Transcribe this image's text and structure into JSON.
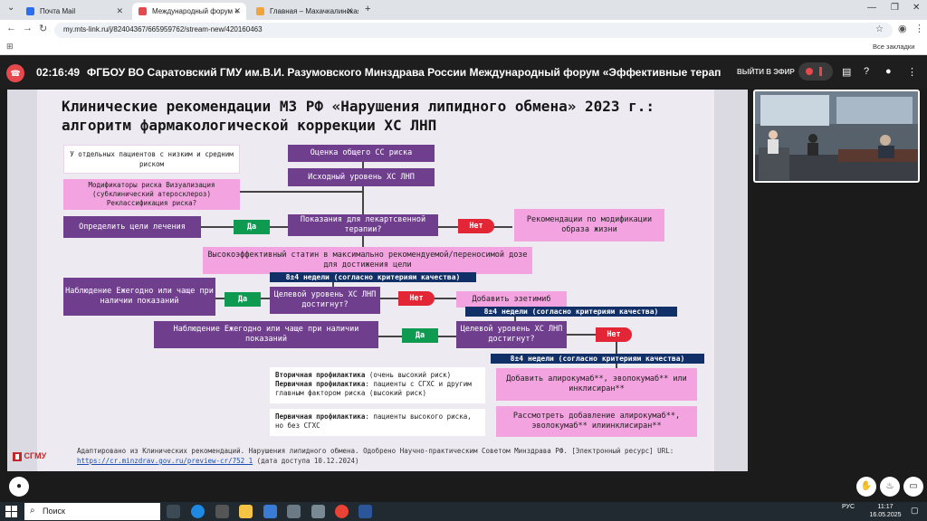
{
  "browser": {
    "tabs": [
      {
        "label": "Почта Mail",
        "active": false,
        "favicon_color": "#2a6ff0"
      },
      {
        "label": "Международный форум «",
        "active": true,
        "favicon_color": "#e5484d"
      },
      {
        "label": "Главная – Махачкалинская кл",
        "active": false,
        "favicon_color": "#f0a43a"
      }
    ],
    "new_tab": "+",
    "url": "my.mts-link.ru/j/82404367/665959762/stream-new/420160463",
    "bookmarks_label": "Все закладки"
  },
  "stream": {
    "timer": "02:16:49",
    "title": "ФГБОУ ВО Саратовский ГМУ им.В.И. Разумовского Минздрава России   Международный форум «Эффективные терапевтические страт",
    "leave_label": "ВЫЙТИ В ЭФИР"
  },
  "slide": {
    "title": "Клинические рекомендации МЗ РФ «Нарушения липидного обмена» 2023 г.: алгоритм фармакологической коррекции ХС ЛНП",
    "boxes": {
      "low_risk": "У отдельных  пациентов с низким и средним риском",
      "assess_risk": "Оценка общего СС риска",
      "baseline_ldl": "Исходный уровень ХС ЛНП",
      "modifiers": "Модификаторы риска Визуализация (субклинический атеросклероз) Реклассификация риска?",
      "define_goals": "Определить цели лечения",
      "yes_1": "Да",
      "indications": "Показания для лекартсвенной терапии?",
      "no_1": "Нет",
      "lifestyle": "Рекомендации по модификации образа жизни",
      "high_statin": "Высокоэффективный статин в максимально рекомендуемой/переносимой дозе  для достижения цели",
      "weeks_1": "8±4 недели (согласно критериям качества)",
      "observe_1": "Наблюдение Ежегодно или чаще при наличии показаний",
      "yes_2": "Да",
      "target_1": "Целевой уровень ХС ЛНП достигнут?",
      "no_2": "Нет",
      "add_ezetimibe": "Добавить эзетимиб",
      "weeks_2": "8±4 недели (согласно критериям качества)",
      "observe_2": "Наблюдение Ежегодно или чаще при наличии показаний",
      "yes_3": "Да",
      "target_2": "Целевой уровень ХС ЛНП достигнут?",
      "no_3": "Нет",
      "weeks_3": "8±4 недели (согласно критериям качества)",
      "add_pcsk9": "Добавить алирокумаб**, эволокумаб** или инклисиран**",
      "consider_pcsk9": "Рассмотреть добавление алирокумаб**, эволокумаб** илиинклисиран**"
    },
    "notes": {
      "note1_bold1": "Вторичная профилактика",
      "note1_text1": " (очень высокий риск)",
      "note1_bold2": "Первичная профилактика",
      "note1_text2": ": пациенты с СГХС и другим главным фактором риска (высокий риск)",
      "note2_bold": "Первичная профилактика",
      "note2_text": ": пациенты высокого риска, но без СГХС"
    },
    "footnote_text": "Адаптировано из Клинических рекомендаций. Нарушения липидного обмена. Одобрено Научно-практическим Советом Минздрава РФ. [Электронный ресурс] URL:",
    "footnote_link": "https://cr.minzdrav.gov.ru/preview-cr/752_1",
    "footnote_date": " (дата доступа 10.12.2024)",
    "logo": "СГМУ"
  },
  "taskbar": {
    "search_label": "Поиск",
    "lang": "РУС",
    "time": "11:17",
    "date": "16.05.2025"
  }
}
